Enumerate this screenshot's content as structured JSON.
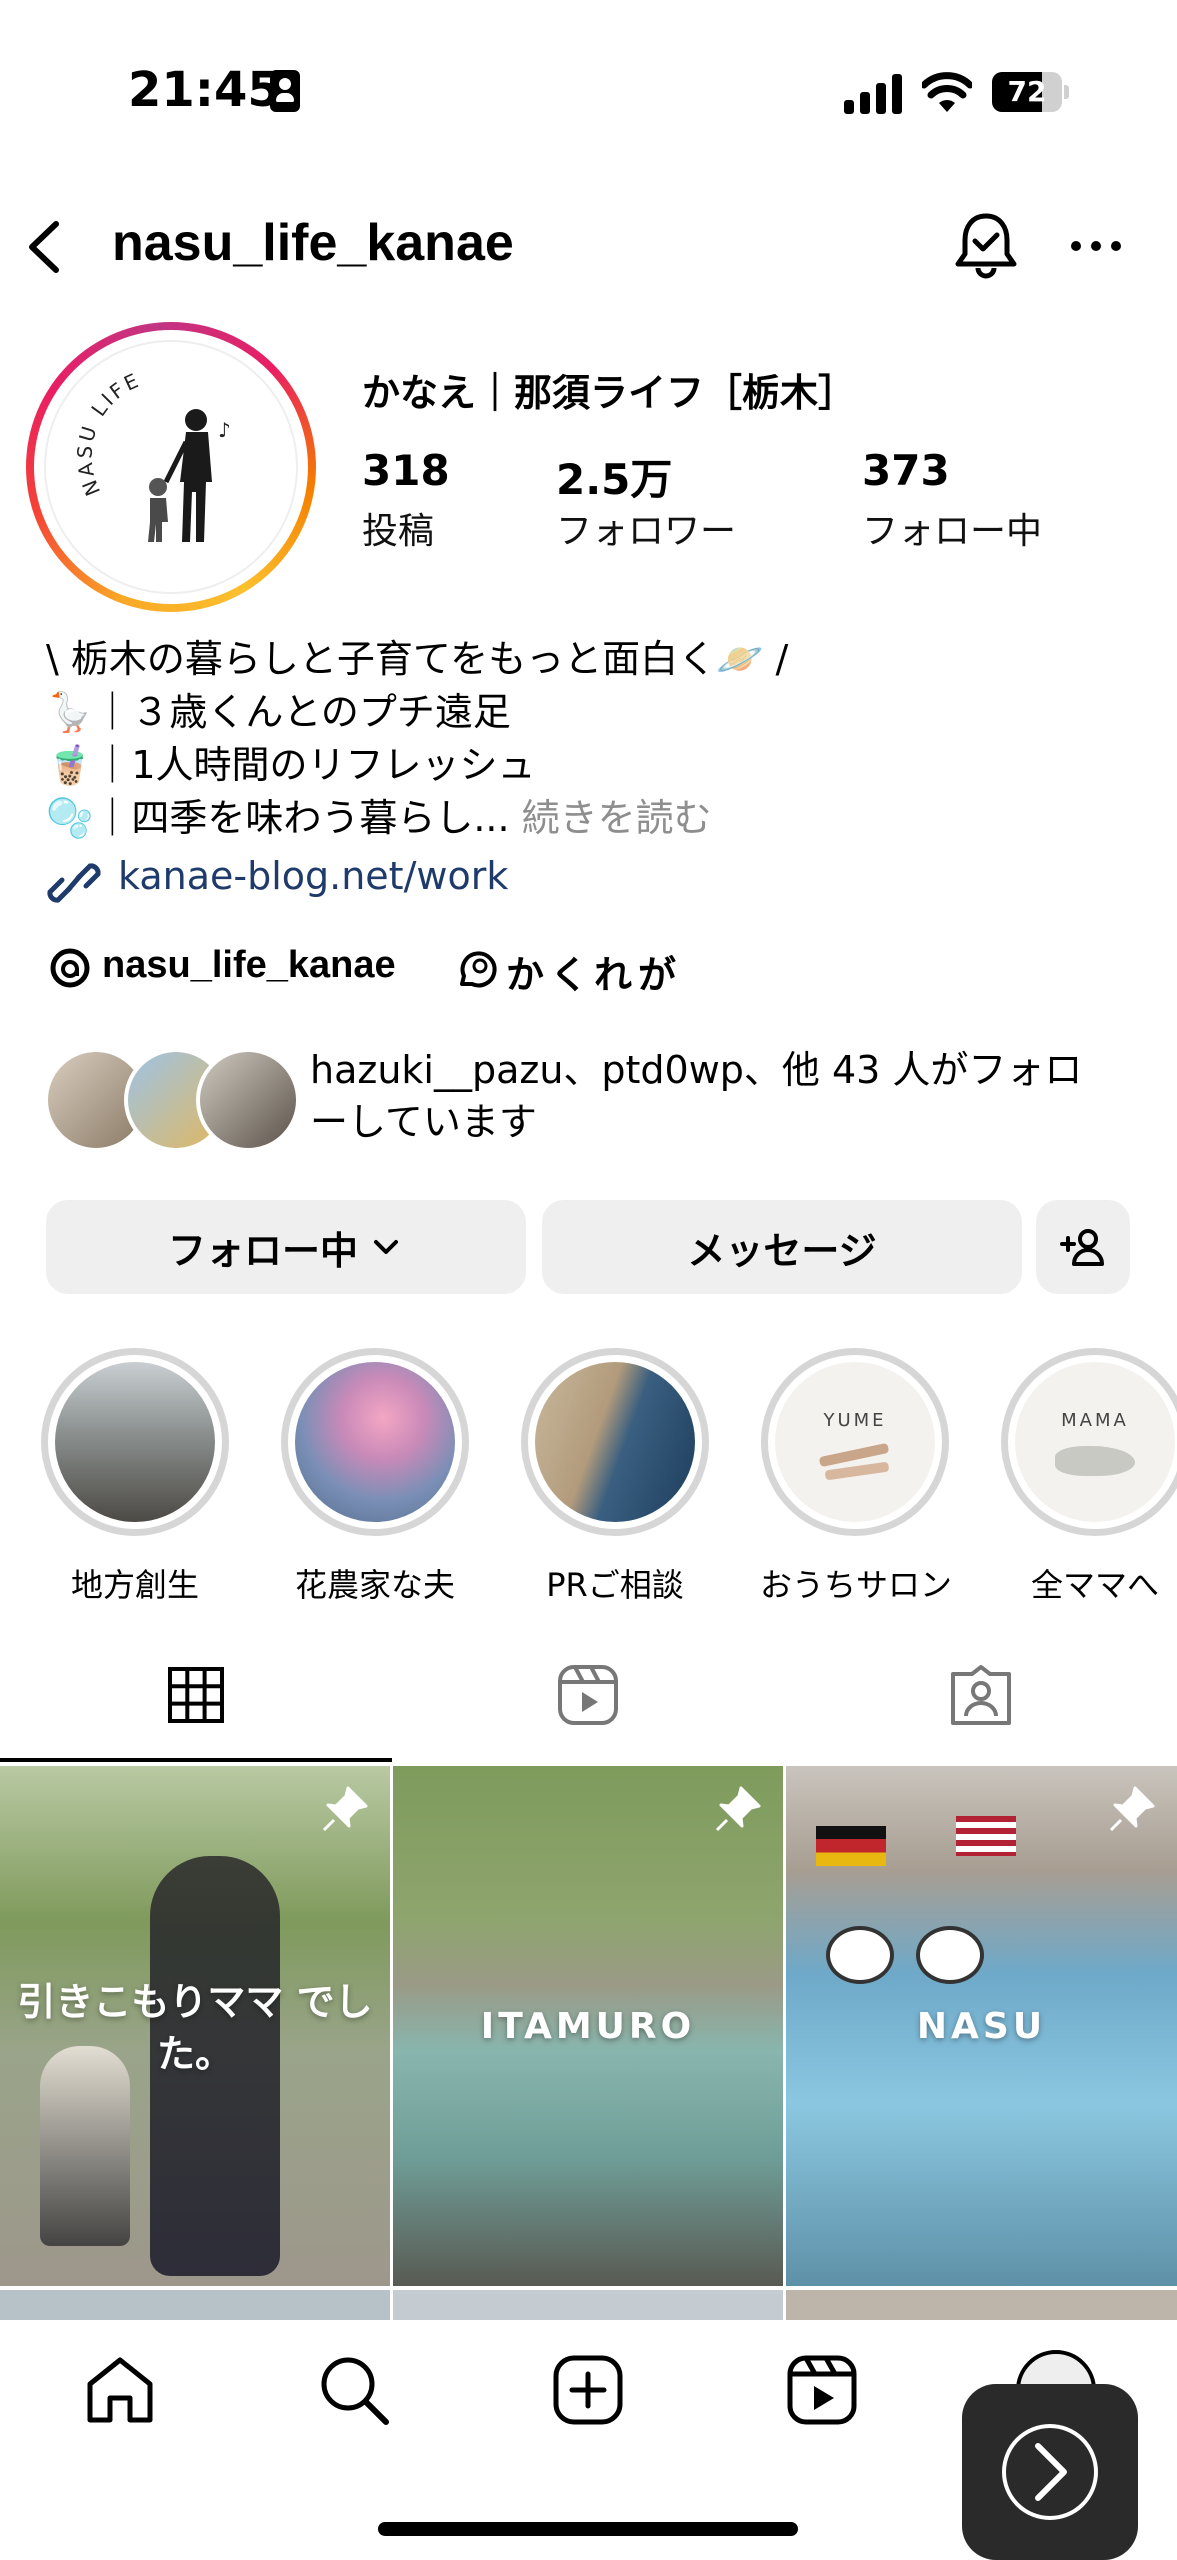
{
  "status_bar": {
    "time": "21:45",
    "battery_percent": 72,
    "battery_label": "72"
  },
  "header": {
    "username": "nasu_life_kanae"
  },
  "profile": {
    "display_name": "かなえ｜那須ライフ［栃木］",
    "stats": [
      {
        "value": "318",
        "label": "投稿"
      },
      {
        "value": "2.5万",
        "label": "フォロワー"
      },
      {
        "value": "373",
        "label": "フォロー中"
      }
    ],
    "bio_lines": [
      "\\ 栃木の暮らしと子育てをもっと面白く🪐 /",
      "🪿｜３歳くんとのプチ遠足",
      "🧋｜1人時間のリフレッシュ",
      "🫧｜四季を味わう暮らし..."
    ],
    "bio_more": "続きを読む",
    "link": "kanae-blog.net/work",
    "threads_name": "nasu_life_kanae",
    "threads_tag": "かくれが",
    "mutual_text": "hazuki__pazu、ptd0wp、他 43 人がフォロ ーしています",
    "avatar_text": "NASU LIFE"
  },
  "actions": {
    "following_label": "フォロー中",
    "message_label": "メッセージ"
  },
  "highlights": [
    {
      "label": "地方創生"
    },
    {
      "label": "花農家な夫"
    },
    {
      "label": "PRご相談"
    },
    {
      "label": "おうちサロン",
      "inner_text": "YUME"
    },
    {
      "label": "全ママへ",
      "inner_text": "MAMA"
    }
  ],
  "grid": [
    {
      "caption": "引きこもりママ でした。"
    },
    {
      "caption": "ITAMURO"
    },
    {
      "caption": "NASU"
    }
  ],
  "colors": {
    "link": "#1f3b6b",
    "button_bg": "#efefef",
    "secondary_text": "#8e8e8e"
  }
}
